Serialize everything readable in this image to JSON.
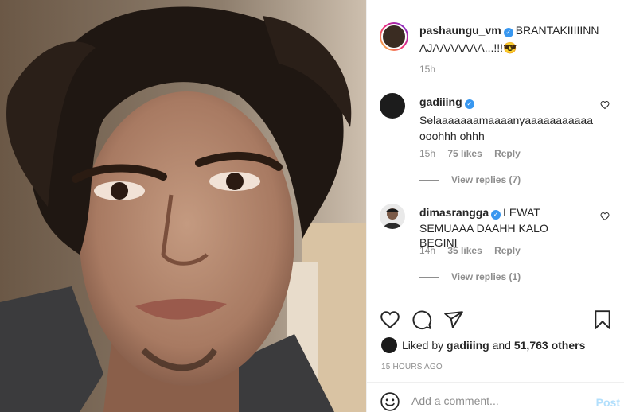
{
  "post": {
    "author": "pashaungu_vm",
    "caption_line1": "BRANTAKIIIIINN",
    "caption_line2": "AJAAAAAAA...!!!😎",
    "time": "15h"
  },
  "comments": [
    {
      "user": "gadiiing",
      "text_line1": "Selaaaaaaamaaaanyaaaaaaaaaaa",
      "text_line2": "ooohhh ohhh",
      "time": "15h",
      "likes": "75 likes",
      "reply": "Reply",
      "view_replies": "View replies (7)"
    },
    {
      "user": "dimasrangga",
      "text_line1": "LEWAT",
      "text_line2": "SEMUAAA DAAHH KALO BEGINI",
      "time": "14h",
      "likes": "35 likes",
      "reply": "Reply",
      "view_replies": "View replies (1)"
    }
  ],
  "likes": {
    "prefix": "Liked by",
    "user": "gadiiing",
    "conj": "and",
    "count": "51,763 others"
  },
  "timestamp": "15 HOURS AGO",
  "add_comment": {
    "placeholder": "Add a comment...",
    "post_label": "Post"
  },
  "icons": {
    "like": "heart-icon",
    "comment": "comment-icon",
    "share": "paper-plane-icon",
    "save": "bookmark-icon",
    "emoji": "smiley-icon",
    "verified": "verified-badge-icon"
  },
  "colors": {
    "verified": "#3897f0",
    "post_disabled": "#b2dffc",
    "muted": "#8e8e8e",
    "text": "#262626"
  }
}
